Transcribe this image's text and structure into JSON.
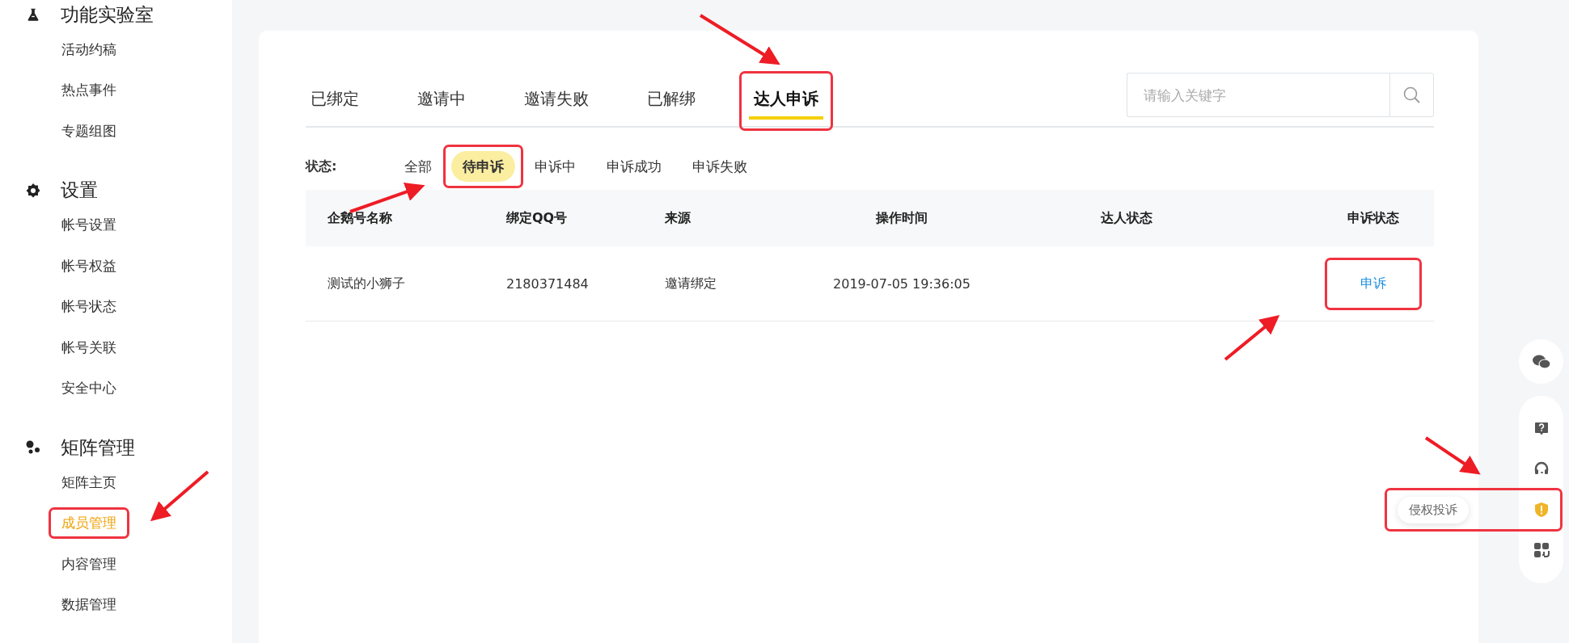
{
  "sidebar": {
    "sections": [
      {
        "kind": "flask",
        "title": "功能实验室",
        "items": [
          {
            "label": "活动约稿",
            "selected": false
          },
          {
            "label": "热点事件",
            "selected": false
          },
          {
            "label": "专题组图",
            "selected": false
          }
        ]
      },
      {
        "kind": "gear",
        "title": "设置",
        "items": [
          {
            "label": "帐号设置",
            "selected": false
          },
          {
            "label": "帐号权益",
            "selected": false
          },
          {
            "label": "帐号状态",
            "selected": false
          },
          {
            "label": "帐号关联",
            "selected": false
          },
          {
            "label": "安全中心",
            "selected": false
          }
        ]
      },
      {
        "kind": "dots",
        "title": "矩阵管理",
        "items": [
          {
            "label": "矩阵主页",
            "selected": false
          },
          {
            "label": "成员管理",
            "selected": true,
            "highlighted": true
          },
          {
            "label": "内容管理",
            "selected": false
          },
          {
            "label": "数据管理",
            "selected": false
          }
        ]
      }
    ]
  },
  "tabs": [
    {
      "label": "已绑定",
      "selected": false
    },
    {
      "label": "邀请中",
      "selected": false
    },
    {
      "label": "邀请失败",
      "selected": false
    },
    {
      "label": "已解绑",
      "selected": false
    },
    {
      "label": "达人申诉",
      "selected": true,
      "highlighted": true
    }
  ],
  "search": {
    "placeholder": "请输入关键字"
  },
  "filter": {
    "label": "状态:",
    "options": [
      {
        "label": "全部",
        "selected": false
      },
      {
        "label": "待申诉",
        "selected": true,
        "highlighted": true
      },
      {
        "label": "申诉中",
        "selected": false
      },
      {
        "label": "申诉成功",
        "selected": false
      },
      {
        "label": "申诉失败",
        "selected": false
      }
    ]
  },
  "table": {
    "columns": [
      "企鹅号名称",
      "绑定QQ号",
      "来源",
      "操作时间",
      "达人状态",
      "申诉状态"
    ],
    "rows": [
      {
        "name": "测试的小狮子",
        "qq": "2180371484",
        "source": "邀请绑定",
        "time": "2019-07-05 19:36:05",
        "action": {
          "label": "申诉",
          "highlighted": true
        }
      }
    ]
  },
  "float_bar": {
    "items": [
      {
        "kind": "wechat"
      },
      {
        "kind": "help"
      },
      {
        "kind": "headset"
      },
      {
        "kind": "shield",
        "tooltip": "侵权投诉",
        "highlighted": true
      },
      {
        "kind": "qr"
      }
    ]
  }
}
